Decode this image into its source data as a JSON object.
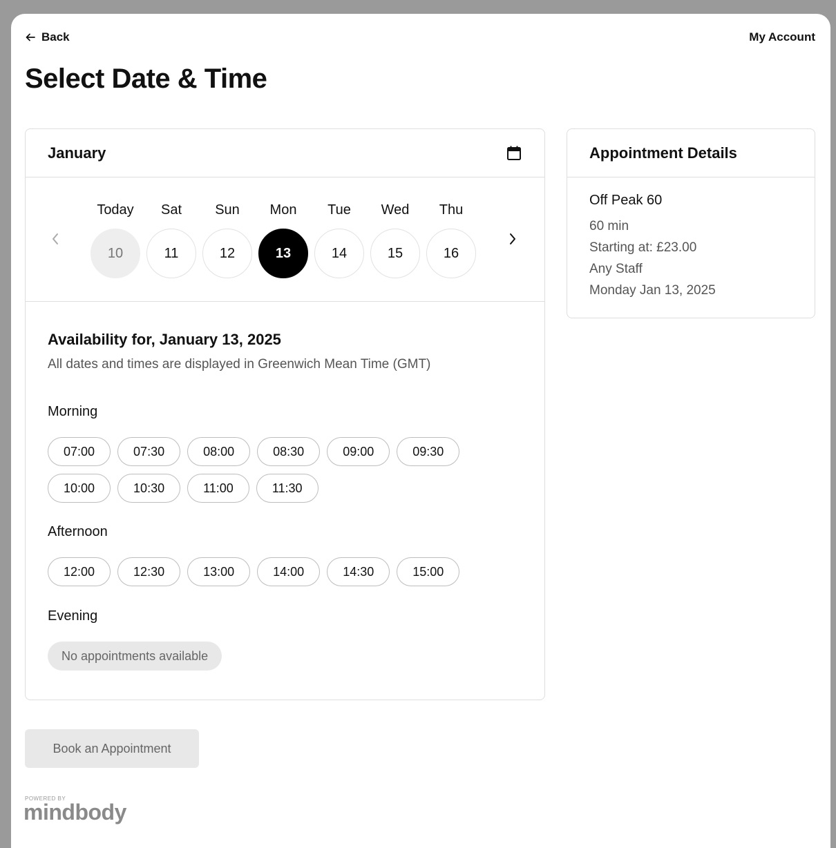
{
  "nav": {
    "back_label": "Back",
    "account_label": "My Account"
  },
  "page": {
    "title": "Select Date & Time"
  },
  "calendar": {
    "month": "January",
    "days": [
      {
        "name": "Today",
        "num": "10",
        "state": "today"
      },
      {
        "name": "Sat",
        "num": "11",
        "state": "normal"
      },
      {
        "name": "Sun",
        "num": "12",
        "state": "normal"
      },
      {
        "name": "Mon",
        "num": "13",
        "state": "selected"
      },
      {
        "name": "Tue",
        "num": "14",
        "state": "normal"
      },
      {
        "name": "Wed",
        "num": "15",
        "state": "normal"
      },
      {
        "name": "Thu",
        "num": "16",
        "state": "normal"
      }
    ]
  },
  "availability": {
    "title": "Availability for, January 13, 2025",
    "subtitle": "All dates and times are displayed in Greenwich Mean Time (GMT)",
    "morning_label": "Morning",
    "morning_slots": [
      "07:00",
      "07:30",
      "08:00",
      "08:30",
      "09:00",
      "09:30",
      "10:00",
      "10:30",
      "11:00",
      "11:30"
    ],
    "afternoon_label": "Afternoon",
    "afternoon_slots": [
      "12:00",
      "12:30",
      "13:00",
      "14:00",
      "14:30",
      "15:00"
    ],
    "evening_label": "Evening",
    "evening_empty": "No appointments available"
  },
  "details": {
    "title": "Appointment Details",
    "service": "Off Peak 60",
    "duration": "60 min",
    "price": "Starting at: £23.00",
    "staff": "Any Staff",
    "date": "Monday Jan 13, 2025"
  },
  "actions": {
    "book_label": "Book an Appointment"
  },
  "footer": {
    "powered_by": "POWERED BY",
    "brand": "mindbody"
  },
  "colors": {
    "selected": "#000000",
    "today_bg": "#eeeeee",
    "disabled_bg": "#e8e8e8"
  }
}
